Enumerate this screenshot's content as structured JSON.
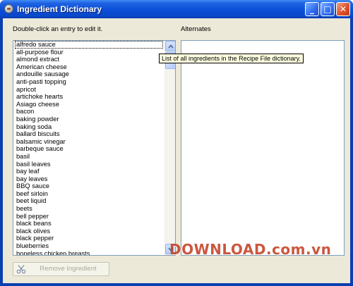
{
  "window": {
    "title": "Ingredient Dictionary",
    "controls": {
      "minimize": "_",
      "maximize": "□",
      "close": "✕"
    }
  },
  "left_label": "Double-click an entry to edit it.",
  "right_label": "Alternates",
  "tooltip": "List of all ingredients in the Recipe File dictionary.",
  "ingredients": [
    "alfredo sauce",
    "all-purpose flour",
    "almond extract",
    "American cheese",
    "andouille sausage",
    "anti-pasti topping",
    "apricot",
    "artichoke hearts",
    "Asiago cheese",
    "bacon",
    "baking powder",
    "baking soda",
    "ballard biscuits",
    "balsamic vinegar",
    "barbeque sauce",
    "basil",
    "basil leaves",
    "bay leaf",
    "bay leaves",
    "BBQ sauce",
    "beef sirloin",
    "beet liquid",
    "beets",
    "bell pepper",
    "black beans",
    "black olives",
    "black pepper",
    "blueberries",
    "boneless chicken breasts"
  ],
  "selected_index": 0,
  "remove_button_label": "Remove Ingredient",
  "watermark": "DOWNLOAD.com.vn",
  "colors": {
    "title_bar": "#0a4fd8",
    "client_bg": "#ece9d8",
    "tooltip_bg": "#ffffe1",
    "watermark": "#c23a1e"
  }
}
